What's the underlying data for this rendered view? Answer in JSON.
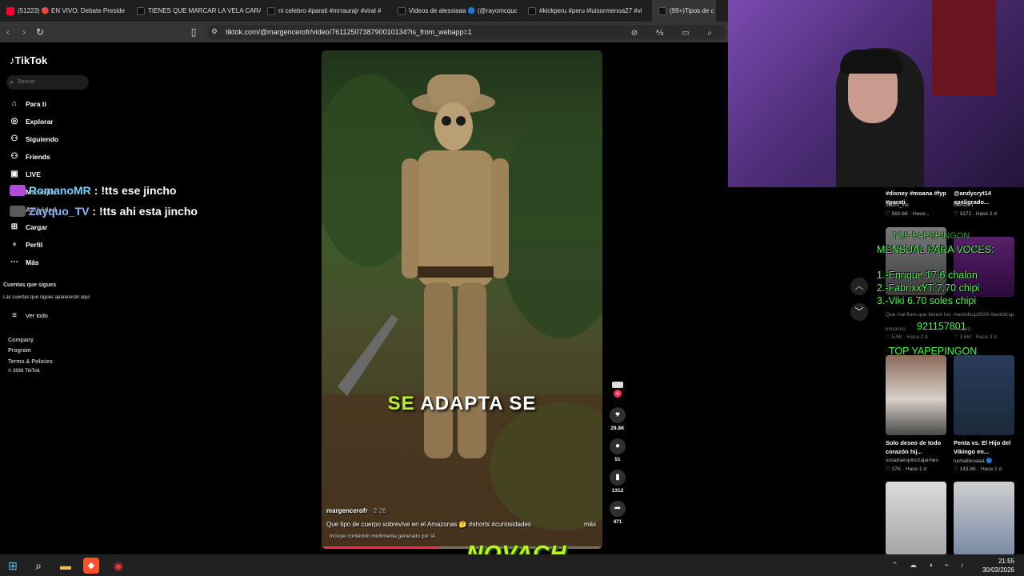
{
  "browser": {
    "tabs": [
      {
        "label": "(51223) 🔴 EN VIVO: Debate Preside",
        "color": "#ff0033"
      },
      {
        "label": "TIENES QUE MARCAR LA VELA CARA",
        "color": "#111111"
      },
      {
        "label": "ni celebro #parati #mrraurajr #viral #",
        "color": "#111111"
      },
      {
        "label": "Videos de alessiaaa 🔵 (@rayomcquc",
        "color": "#111111"
      },
      {
        "label": "#kickperu #peru #luisormenoa27 #vi",
        "color": "#111111"
      },
      {
        "label": "(99+)Tipos de c",
        "color": "#111111"
      }
    ],
    "url": "tiktok.com/@margencerofr/video/7611250738790010134?is_from_webapp=1"
  },
  "sidebar": {
    "logo": "TikTok",
    "search_placeholder": "Buscar",
    "nav": [
      {
        "label": "Para ti",
        "icon": "home-icon",
        "glyph": "⌂"
      },
      {
        "label": "Explorar",
        "icon": "compass-icon",
        "glyph": "◎"
      },
      {
        "label": "Siguiendo",
        "icon": "person-icon",
        "glyph": "⚇"
      },
      {
        "label": "Friends",
        "icon": "friends-icon",
        "glyph": "⚇"
      },
      {
        "label": "LIVE",
        "icon": "live-icon",
        "glyph": "▣"
      },
      {
        "label": "Mensajes",
        "icon": "message-icon",
        "glyph": "✉"
      },
      {
        "label": "Actividad",
        "icon": "bell-icon",
        "glyph": "◔"
      },
      {
        "label": "Cargar",
        "icon": "upload-icon",
        "glyph": "⊞"
      },
      {
        "label": "Perfil",
        "icon": "avatar-icon",
        "glyph": "●"
      },
      {
        "label": "Más",
        "icon": "more-icon",
        "glyph": "⋯"
      }
    ],
    "following_title": "Cuentas que sigues",
    "following_empty": "Las cuentas que sigues aparecerán aquí",
    "see_all": "Ver todo",
    "footer": [
      "Company",
      "Program",
      "Terms & Policies",
      "© 2026 TikTok"
    ]
  },
  "chat": [
    {
      "name": "RomanoMR",
      "message": ": !tts ese jincho"
    },
    {
      "name": "Zayquo_TV",
      "message": ": !tts ahi esta jincho"
    }
  ],
  "video": {
    "caption_highlight": "SE",
    "caption_rest": "ADAPTA SE",
    "author": "margencerofr",
    "date": "· 2-26",
    "description": "Que tipo de cuerpo sobrevive en el Amazonas 🤔 #shorts #curiosidades",
    "more": "más",
    "ai_label": "Incluye contenido multimedia generado por IA",
    "progress": 0.42
  },
  "actions": [
    {
      "icon": "like-icon",
      "glyph": "♥",
      "count": "29.8K"
    },
    {
      "icon": "comment-icon",
      "glyph": "●",
      "count": "51"
    },
    {
      "icon": "bookmark-icon",
      "glyph": "▮",
      "count": "1312"
    },
    {
      "icon": "share-icon",
      "glyph": "➦",
      "count": "471"
    }
  ],
  "recommendations": [
    {
      "title": "#disney #moana #fyp #parati",
      "author": "stanis_life",
      "stats": "♡ 560.6K · Hace..."
    },
    {
      "title": "@andycryt14 apeligrado...",
      "author": "reelsbe1",
      "stats": "♡ 3172 · Hace 2 d"
    },
    {
      "title": "Que mal floro que tienen los",
      "author": "mluorino",
      "stats": "♡ 5.5K · Hace 2 d"
    },
    {
      "title": "#worldcup2026 #worldcup",
      "author": "maxyt3",
      "stats": "♡ 3.6M · Hace 3 d"
    },
    {
      "title": "Solo deseo de todo corazón hij...",
      "author": "susanaespinozajaimes",
      "stats": "♡ 37K · Hace 1 d"
    },
    {
      "title": "Penta vs. El Hijo del Vikingo en...",
      "author": "luchalibreaaa 🔵",
      "stats": "♡ 143.8K · Hace 1 d"
    }
  ],
  "overlay": {
    "title_top": "TOP PAPEPINGON",
    "title": "MENSUAL PARA VOCES:",
    "lines": [
      "1.-Enrique 17.6 chalon",
      "2.-FabrixxYT 7.70 chipi",
      "3.-Viki 6.70 soles chipi"
    ],
    "number": "921157801",
    "footer": "TOP YAPEPINGON"
  },
  "banner": "NOVACH",
  "taskbar": {
    "time": "21:55",
    "date": "30/03/2026"
  },
  "colors": {
    "accent": "#fe2c55",
    "caption_highlight": "#b6f12d",
    "chat_name": "#6fd3ff",
    "overlay_text": "#3cff3c"
  }
}
